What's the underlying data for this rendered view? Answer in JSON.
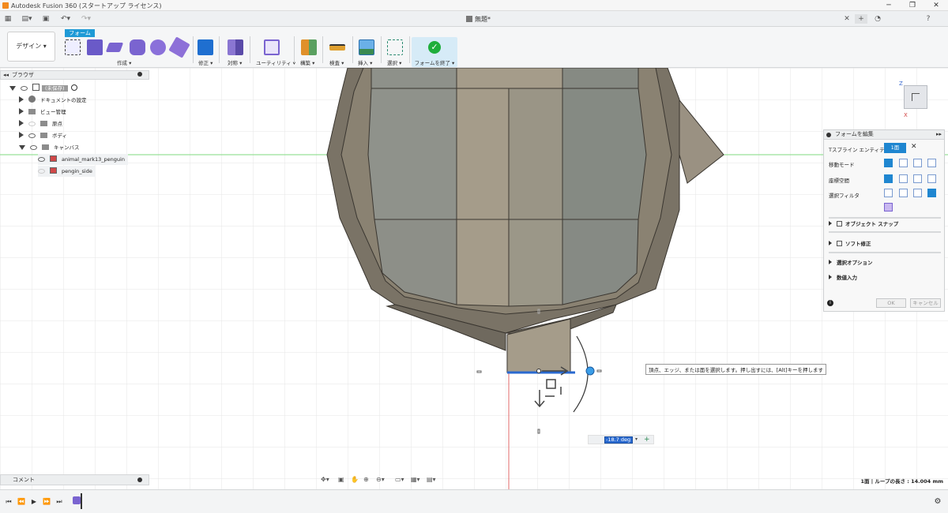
{
  "app": {
    "title": "Autodesk Fusion 360 (スタートアップ ライセンス)",
    "doc_tab": "無題*"
  },
  "workspace": {
    "design_button": "デザイン ▾",
    "form_tab": "フォーム"
  },
  "toolbar": {
    "groups": [
      {
        "label": "作成 ▾"
      },
      {
        "label": "修正 ▾"
      },
      {
        "label": "対称 ▾"
      },
      {
        "label": "ユーティリティ ▾"
      },
      {
        "label": "構築 ▾"
      },
      {
        "label": "検査 ▾"
      },
      {
        "label": "挿入 ▾"
      },
      {
        "label": "選択 ▾"
      }
    ],
    "finish_form": "フォームを終了 ▾"
  },
  "browser": {
    "title": "ブラウザ",
    "root": "(未保存)",
    "items": [
      {
        "label": "ドキュメントの設定"
      },
      {
        "label": "ビュー管理"
      },
      {
        "label": "原点"
      },
      {
        "label": "ボディ"
      },
      {
        "label": "キャンバス"
      }
    ],
    "canvases": [
      {
        "label": "animal_mark13_penguin"
      },
      {
        "label": "pengin_side"
      }
    ]
  },
  "comment": {
    "title": "コメント"
  },
  "viewcube": {
    "label_z": "Z",
    "label_x": "X"
  },
  "edit_form": {
    "title": "フォームを編集",
    "rows": [
      {
        "label": "Tスプライン エンティティ",
        "value": "1面"
      },
      {
        "label": "移動モード"
      },
      {
        "label": "座標空間"
      },
      {
        "label": "選択フィルタ"
      }
    ],
    "sections": [
      {
        "label": "オブジェクト スナップ"
      },
      {
        "label": "ソフト修正"
      },
      {
        "label": "選択オプション"
      },
      {
        "label": "数値入力"
      }
    ],
    "ok": "OK",
    "cancel": "キャンセル"
  },
  "tooltip": "頂点、エッジ、または面を選択します。押し出すには、[Alt]キーを押します",
  "angle_input": {
    "value": "-18.7 deg"
  },
  "status": "1面 | ループの長さ : 14.004 mm",
  "colors": {
    "accent": "#1f9ad6",
    "finish_check": "#1fae3c",
    "mesh_face": "#8a8f84",
    "mesh_edge": "#7a7366",
    "highlight_face": "#a59c8a"
  }
}
